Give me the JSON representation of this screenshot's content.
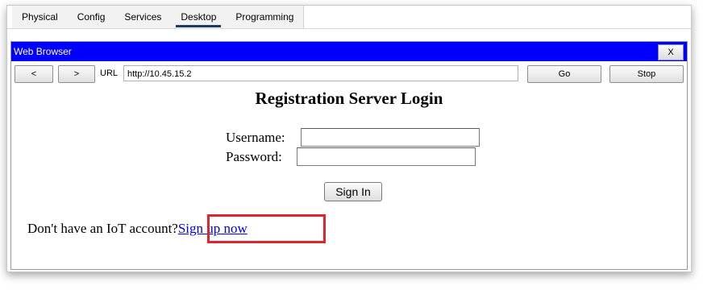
{
  "tabs": [
    {
      "label": "Physical"
    },
    {
      "label": "Config"
    },
    {
      "label": "Services"
    },
    {
      "label": "Desktop"
    },
    {
      "label": "Programming"
    }
  ],
  "active_tab": "Desktop",
  "browser": {
    "title": "Web Browser",
    "close_label": "X",
    "back_label": "<",
    "forward_label": ">",
    "url_label": "URL",
    "url_value": "http://10.45.15.2",
    "go_label": "Go",
    "stop_label": "Stop"
  },
  "page": {
    "heading": "Registration Server Login",
    "username_label": "Username:",
    "password_label": "Password:",
    "username_value": "",
    "password_value": "",
    "signin_label": "Sign In",
    "prompt_text": "Don't have an IoT account?",
    "signup_link": "Sign up now"
  },
  "colors": {
    "titlebar": "#0000ff",
    "highlight_box": "#e0242c",
    "link": "#0000ee"
  }
}
